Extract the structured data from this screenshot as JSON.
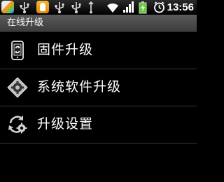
{
  "status_bar": {
    "notification_icons": [
      "app-icon",
      "usb-icon",
      "sticker-app-icon",
      "usb-icon",
      "usb-icon"
    ],
    "system_icons": [
      "usb-connected-icon",
      "wifi-icon",
      "signal-icon",
      "battery-charging-icon",
      "alarm-icon"
    ],
    "time": "13:56"
  },
  "title_bar": {
    "title": "在线升级"
  },
  "menu": {
    "items": [
      {
        "label": "固件升级",
        "icon": "phone-refresh-icon"
      },
      {
        "label": "系统软件升级",
        "icon": "gear-puzzle-icon"
      },
      {
        "label": "升级设置",
        "icon": "refresh-gear-icon"
      }
    ]
  },
  "colors": {
    "background": "#000000",
    "title_bar": "#4a4a4a",
    "divider": "#3a3a3a",
    "battery_charge": "#5fcf2f"
  }
}
